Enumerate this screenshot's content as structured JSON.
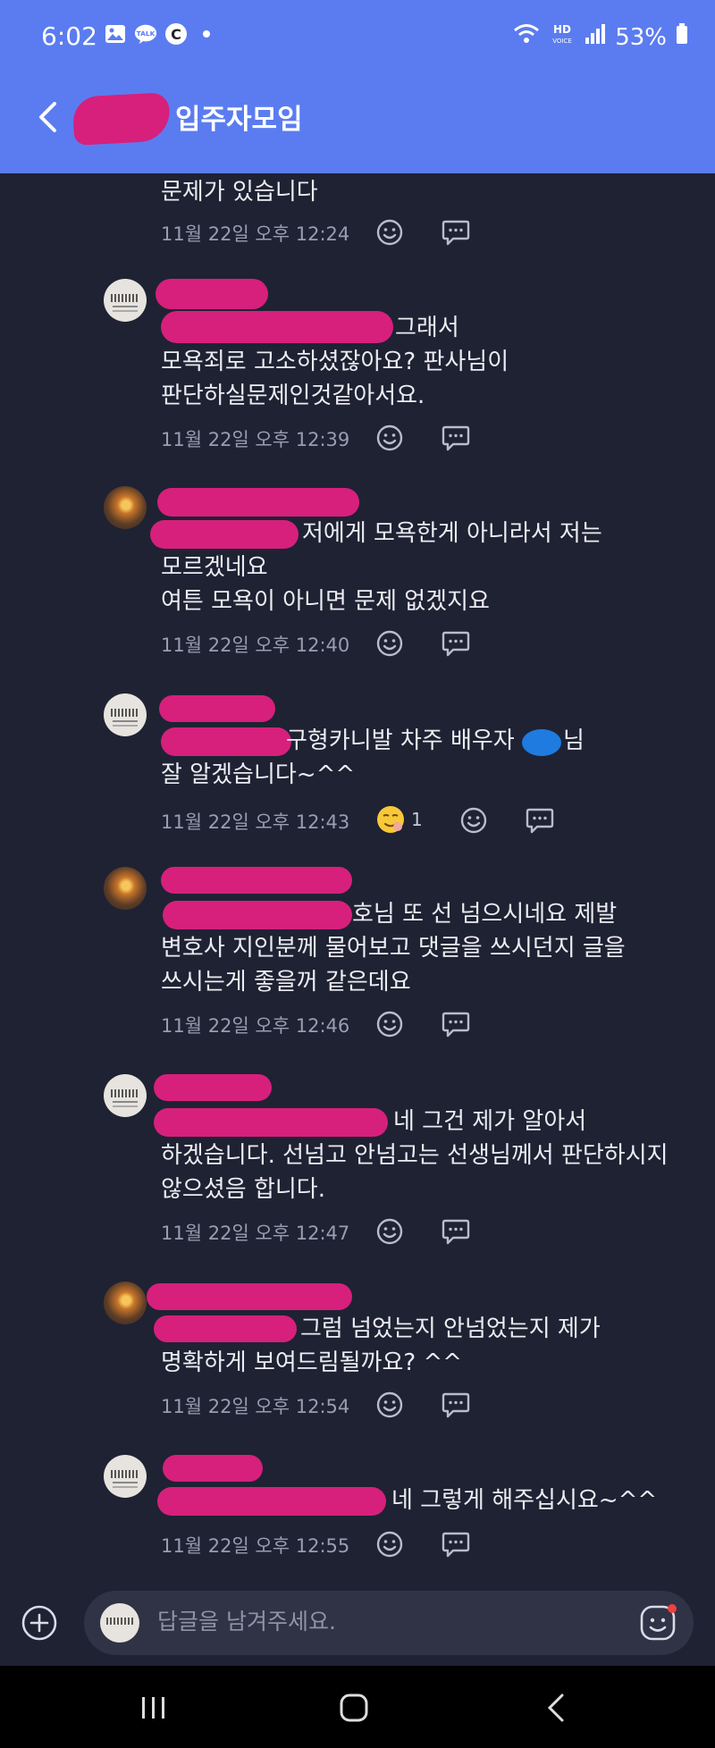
{
  "status_bar": {
    "time": "6:02",
    "battery": "53%",
    "left_icons": [
      "gallery-icon",
      "talk-icon",
      "c-app-icon",
      "dot-icon"
    ],
    "right_icons": [
      "wifi-icon",
      "hd-voice-icon",
      "signal-icon",
      "battery-icon"
    ],
    "hd_label": "HD",
    "voice_label": "VOICE",
    "talk_label": "TALK",
    "c_label": "C"
  },
  "header": {
    "title": "입주자모임"
  },
  "messages": [
    {
      "lines": [
        "문제가 있습니다"
      ],
      "time": "11월 22일 오후 12:24"
    },
    {
      "avatar": "document",
      "lines": [
        "그래서",
        "모욕죄로 고소하셨잖아요? 판사님이",
        "판단하실문제인것같아서요."
      ],
      "time": "11월 22일 오후 12:39"
    },
    {
      "avatar": "sunset",
      "lines": [
        "저에게 모욕한게 아니라서 저는",
        "모르겠네요",
        "여튼 모욕이 아니면 문제 없겠지요"
      ],
      "time": "11월 22일 오후 12:40"
    },
    {
      "avatar": "document",
      "lines": [
        "구형카니발 차주 배우자",
        "님",
        "잘 알겠습니다~^^"
      ],
      "time": "11월 22일 오후 12:43",
      "reaction_count": "1"
    },
    {
      "avatar": "sunset",
      "lines": [
        "호님 또 선 넘으시네요 제발",
        "변호사 지인분께 물어보고 댓글을 쓰시던지 글을",
        "쓰시는게 좋을꺼 같은데요"
      ],
      "time": "11월 22일 오후 12:46"
    },
    {
      "avatar": "document",
      "lines": [
        "네 그건 제가 알아서",
        "하겠습니다. 선넘고 안넘고는 선생님께서 판단하시지",
        "않으셨음 합니다."
      ],
      "time": "11월 22일 오후 12:47"
    },
    {
      "avatar": "sunset",
      "lines": [
        "그럼 넘었는지 안넘었는지 제가",
        "명확하게 보여드림될까요? ^^"
      ],
      "time": "11월 22일 오후 12:54"
    },
    {
      "avatar": "document",
      "lines": [
        "네 그렇게 해주십시요~^^"
      ],
      "time": "11월 22일 오후 12:55"
    }
  ],
  "composer": {
    "placeholder": "답글을 남겨주세요."
  },
  "colors": {
    "header_bg": "#5b7cf0",
    "body_bg": "#1f2233",
    "redaction": "#d6207c",
    "mention": "#7fa2f4"
  }
}
